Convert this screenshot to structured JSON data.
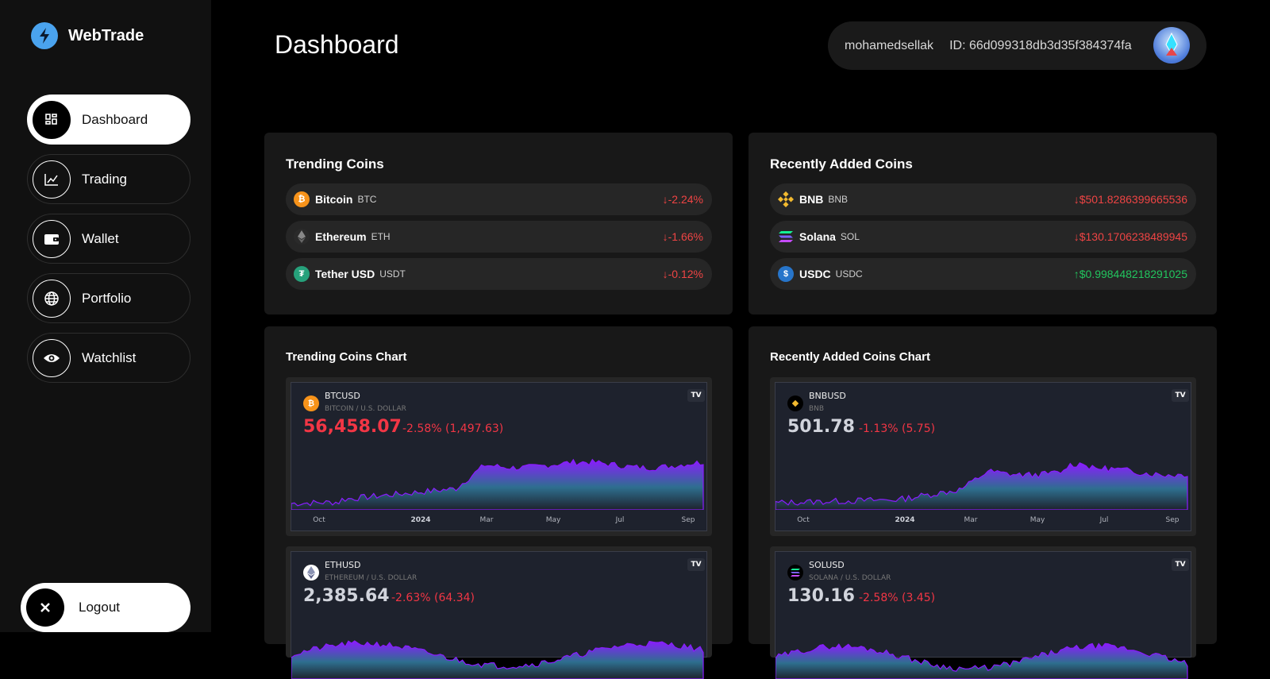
{
  "app": {
    "name": "WebTrade"
  },
  "nav": {
    "items": [
      {
        "label": "Dashboard",
        "icon": "dashboard-icon",
        "active": true
      },
      {
        "label": "Trading",
        "icon": "chart-line-icon"
      },
      {
        "label": "Wallet",
        "icon": "wallet-icon"
      },
      {
        "label": "Portfolio",
        "icon": "globe-icon"
      },
      {
        "label": "Watchlist",
        "icon": "eye-icon"
      }
    ],
    "logout_label": "Logout"
  },
  "header": {
    "title": "Dashboard",
    "username": "mohamedsellak",
    "user_id": "ID: 66d099318db3d35f384374fa"
  },
  "trending": {
    "title": "Trending Coins",
    "coins": [
      {
        "name": "Bitcoin",
        "symbol": "BTC",
        "change": "-2.24%",
        "direction": "down",
        "color": "#f7931a"
      },
      {
        "name": "Ethereum",
        "symbol": "ETH",
        "change": "-1.66%",
        "direction": "down",
        "color": "#3a3a3a"
      },
      {
        "name": "Tether USD",
        "symbol": "USDT",
        "change": "-0.12%",
        "direction": "down",
        "color": "#26a17b"
      }
    ]
  },
  "recent": {
    "title": "Recently Added Coins",
    "coins": [
      {
        "name": "BNB",
        "symbol": "BNB",
        "change": "$501.8286399665536",
        "direction": "down",
        "color": "#f3ba2f"
      },
      {
        "name": "Solana",
        "symbol": "SOL",
        "change": "$130.1706238489945",
        "direction": "down",
        "color": "#9945ff"
      },
      {
        "name": "USDC",
        "symbol": "USDC",
        "change": "$0.998448218291025",
        "direction": "up",
        "color": "#2775ca"
      }
    ]
  },
  "trending_chart": {
    "title": "Trending Coins Chart"
  },
  "recent_chart": {
    "title": "Recently Added Coins Chart"
  },
  "mini_charts": {
    "btc": {
      "symbol": "BTCUSD",
      "desc": "BITCOIN / U.S. DOLLAR",
      "price": "56,458.07",
      "delta": "-2.58% (1,497.63)",
      "icon_color": "#f7931a",
      "icon": "bitcoin-icon"
    },
    "bnb": {
      "symbol": "BNBUSD",
      "desc": "BNB",
      "price": "501.78",
      "delta": "-1.13% (5.75)",
      "icon_color": "#000000",
      "icon": "bnb-icon"
    },
    "eth": {
      "symbol": "ETHUSD",
      "desc": "ETHEREUM / U.S. DOLLAR",
      "price": "2,385.64",
      "delta": "-2.63% (64.34)",
      "icon_color": "#ffffff",
      "icon": "ethereum-icon"
    },
    "sol": {
      "symbol": "SOLUSD",
      "desc": "SOLANA / U.S. DOLLAR",
      "price": "130.16",
      "delta": "-2.58% (3.45)",
      "icon_color": "#000000",
      "icon": "solana-icon"
    }
  },
  "axis_labels": [
    "Oct",
    "2024",
    "Mar",
    "May",
    "Jul",
    "Sep"
  ],
  "tv_badge": "TV"
}
